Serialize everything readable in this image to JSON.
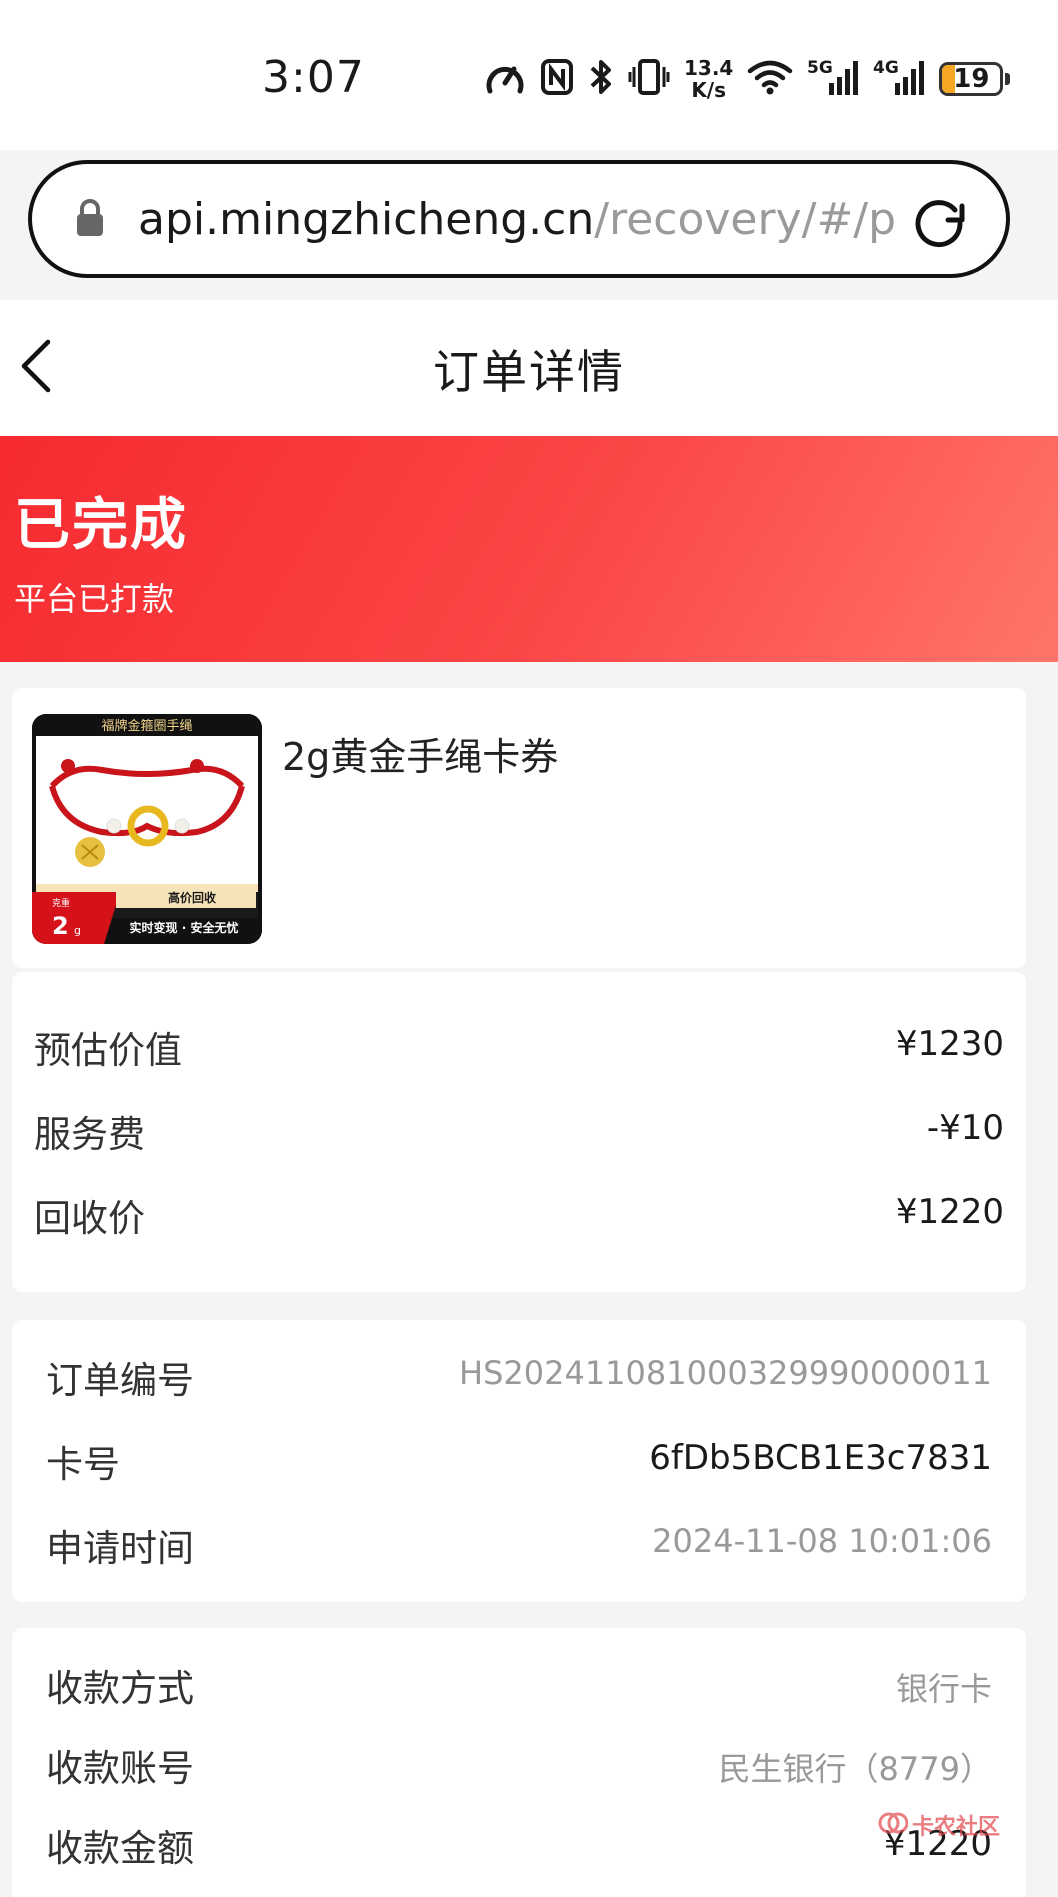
{
  "status_bar": {
    "time": "3:07",
    "net_speed_value": "13.4",
    "net_speed_unit": "K/s",
    "signal_5g": "5G",
    "signal_4g": "4G",
    "battery_level": "19",
    "icons": [
      "speedometer-icon",
      "nfc-icon",
      "bluetooth-icon",
      "vibrate-icon",
      "wifi-icon",
      "signal-5g-icon",
      "signal-4g-icon",
      "battery-icon"
    ]
  },
  "browser": {
    "url_host": "api.mingzhicheng.cn",
    "url_path": "/recovery/#/p",
    "icons": [
      "lock-icon",
      "reload-icon"
    ]
  },
  "header": {
    "title": "订单详情",
    "back_icon": "chevron-left-icon"
  },
  "banner": {
    "status": "已完成",
    "subtitle": "平台已打款",
    "colors": {
      "start": "#f52a2f",
      "end": "#ff7569"
    }
  },
  "product": {
    "name": "2g黄金手绳卡券",
    "image": {
      "top_label": "福牌金箍圈手绳",
      "weight_caption": "克重",
      "weight_value": "2",
      "weight_unit": "g",
      "promo_top": "高价回收",
      "promo_bottom": "实时变现 · 安全无忧"
    }
  },
  "pricing": {
    "rows": [
      {
        "label": "预估价值",
        "value": "¥1230"
      },
      {
        "label": "服务费",
        "value": "-¥10"
      },
      {
        "label": "回收价",
        "value": "¥1220"
      }
    ]
  },
  "order": {
    "rows": [
      {
        "label": "订单编号",
        "value": "HS202411081000329990000011"
      },
      {
        "label": "卡号",
        "value": "6fDb5BCB1E3c7831"
      },
      {
        "label": "申请时间",
        "value": "2024-11-08 10:01:06"
      }
    ]
  },
  "payment": {
    "rows": [
      {
        "label": "收款方式",
        "value": "银行卡"
      },
      {
        "label": "收款账号",
        "value": "民生银行（8779）"
      },
      {
        "label": "收款金额",
        "value": "¥1220"
      }
    ]
  },
  "watermark": {
    "text": "卡农社区"
  }
}
